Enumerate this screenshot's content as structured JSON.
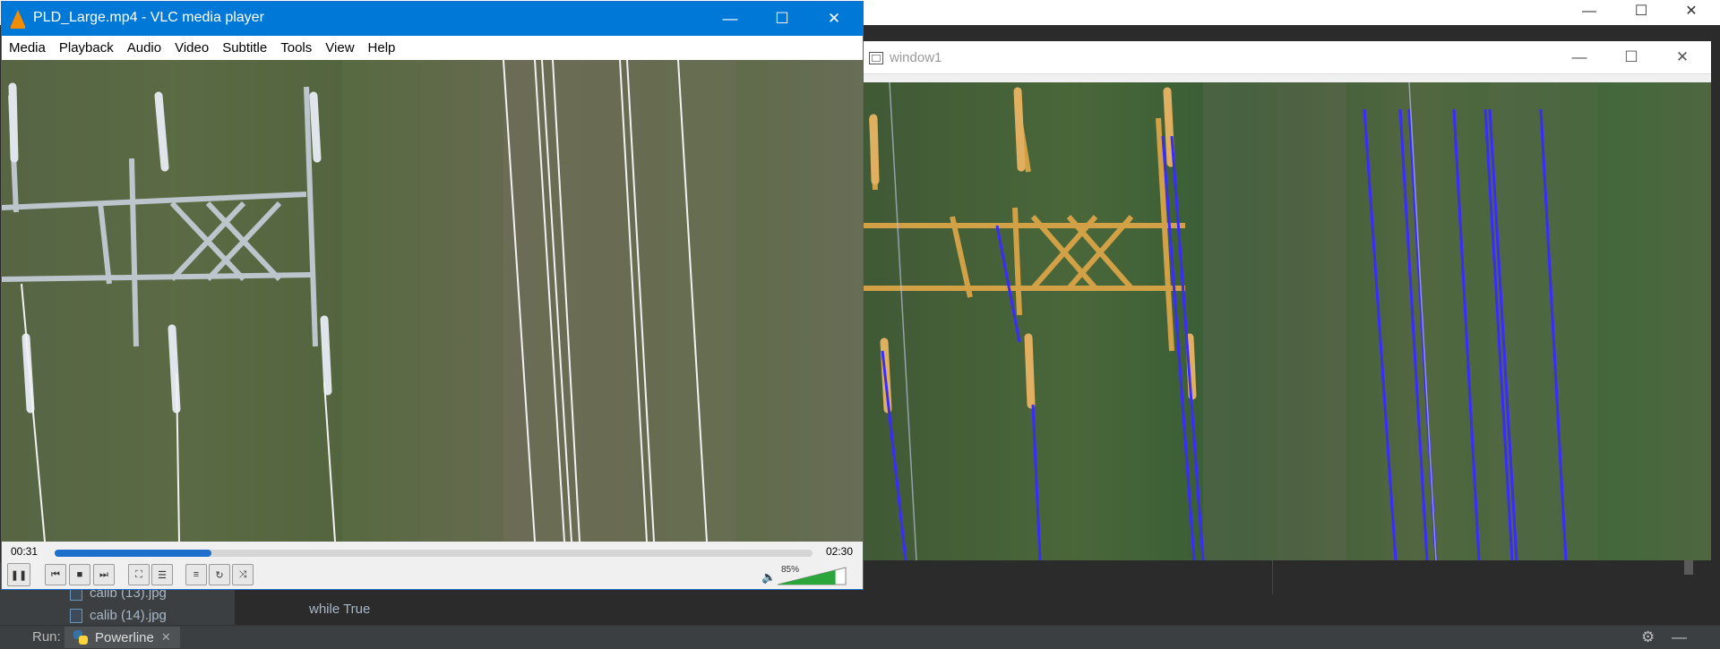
{
  "vlc": {
    "title": "PLD_Large.mp4 - VLC media player",
    "menu": [
      "Media",
      "Playback",
      "Audio",
      "Video",
      "Subtitle",
      "Tools",
      "View",
      "Help"
    ],
    "time_elapsed": "00:31",
    "time_total": "02:30",
    "progress_fraction": 0.207,
    "volume": "85%",
    "volume_fraction": 0.85
  },
  "window1": {
    "title": "window1"
  },
  "ide": {
    "files": [
      "calib (13).jpg",
      "calib (14).jpg"
    ],
    "code_line": "while True",
    "run_label": "Run:",
    "run_tab": "Powerline"
  },
  "icons": {
    "win_minimize": "minimize-icon",
    "win_maximize": "maximize-icon",
    "win_close": "close-icon"
  },
  "colors": {
    "vlc_titlebar": "#0078d7",
    "seek_fill": "#1e6fcb",
    "detected_lines": "#3a2bff",
    "tower_tint": "#d2a146"
  }
}
